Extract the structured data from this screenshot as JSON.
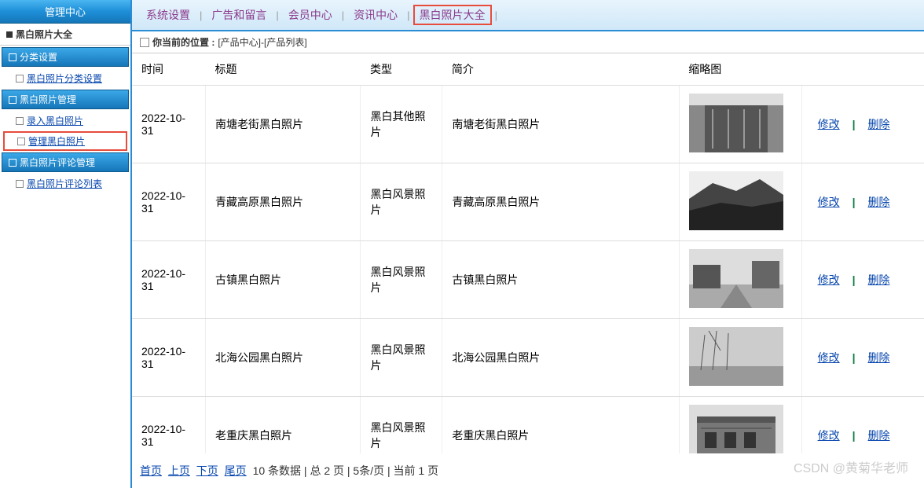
{
  "sidebar": {
    "header": "管理中心",
    "title": "黑白照片大全",
    "sections": [
      {
        "header": "分类设置",
        "items": [
          {
            "label": "黑白照片分类设置",
            "highlighted": false
          }
        ]
      },
      {
        "header": "黑白照片管理",
        "items": [
          {
            "label": "录入黑白照片",
            "highlighted": false
          },
          {
            "label": "管理黑白照片",
            "highlighted": true
          }
        ]
      },
      {
        "header": "黑白照片评论管理",
        "items": [
          {
            "label": "黑白照片评论列表",
            "highlighted": false
          }
        ]
      }
    ]
  },
  "topnav": {
    "items": [
      {
        "label": "系统设置",
        "highlighted": false
      },
      {
        "label": "广告和留言",
        "highlighted": false
      },
      {
        "label": "会员中心",
        "highlighted": false
      },
      {
        "label": "资讯中心",
        "highlighted": false
      },
      {
        "label": "黑白照片大全",
        "highlighted": true
      }
    ],
    "separator": "|"
  },
  "breadcrumb": {
    "prefix": "你当前的位置 : ",
    "path": "[产品中心]-[产品列表]"
  },
  "table": {
    "headers": {
      "time": "时间",
      "title": "标题",
      "type": "类型",
      "intro": "简介",
      "thumb": "缩略图",
      "actions": ""
    },
    "actions": {
      "edit": "修改",
      "delete": "删除",
      "separator": "|"
    },
    "rows": [
      {
        "time": "2022-10-31",
        "title": "南塘老街黑白照片",
        "type": "黑白其他照片",
        "intro": "南塘老街黑白照片"
      },
      {
        "time": "2022-10-31",
        "title": "青藏高原黑白照片",
        "type": "黑白风景照片",
        "intro": "青藏高原黑白照片"
      },
      {
        "time": "2022-10-31",
        "title": "古镇黑白照片",
        "type": "黑白风景照片",
        "intro": "古镇黑白照片"
      },
      {
        "time": "2022-10-31",
        "title": "北海公园黑白照片",
        "type": "黑白风景照片",
        "intro": "北海公园黑白照片"
      },
      {
        "time": "2022-10-31",
        "title": "老重庆黑白照片",
        "type": "黑白风景照片",
        "intro": "老重庆黑白照片"
      }
    ]
  },
  "pagination": {
    "first": "首页",
    "prev": "上页",
    "next": "下页",
    "last": "尾页",
    "info": "10 条数据 | 总 2 页 | 5条/页 | 当前 1 页"
  },
  "watermark": "CSDN @黄菊华老师"
}
